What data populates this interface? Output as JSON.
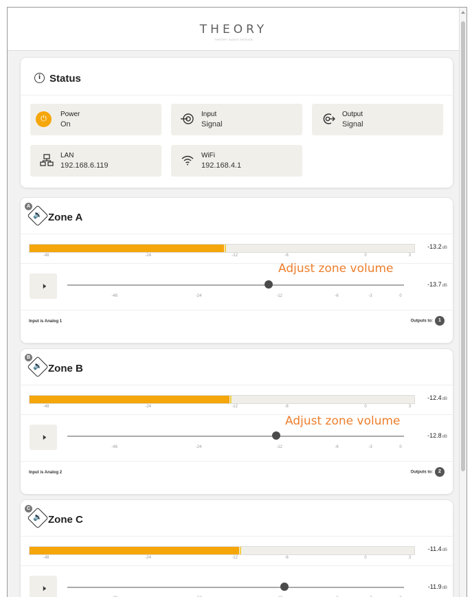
{
  "app": {
    "logo_text": "THEORY",
    "logo_tagline": "THEORY AUDIO DESIGN"
  },
  "status": {
    "title": "Status",
    "info_icon": "i",
    "tiles": [
      {
        "label": "Power",
        "value": "On",
        "icon": "power-icon"
      },
      {
        "label": "Input",
        "value": "Signal",
        "icon": "input-signal-icon"
      },
      {
        "label": "Output",
        "value": "Signal",
        "icon": "output-signal-icon"
      },
      {
        "label": "LAN",
        "value": "192.168.6.119",
        "icon": "lan-icon"
      },
      {
        "label": "WiFi",
        "value": "192.168.4.1",
        "icon": "wifi-icon"
      }
    ]
  },
  "zones": [
    {
      "badge": "A",
      "title": "Zone A",
      "meter_fraction": 0.505,
      "meter_db": "-13.2",
      "slider_fraction": 0.597,
      "slider_db": "-13.7",
      "input_text": "Input is Analog 1",
      "outputs_label": "Outputs to:",
      "outputs_badge": "1",
      "annotation": "Adjust zone volume"
    },
    {
      "badge": "B",
      "title": "Zone B",
      "meter_fraction": 0.52,
      "meter_db": "-12.4",
      "slider_fraction": 0.62,
      "slider_db": "-12.8",
      "input_text": "Input is Analog 2",
      "outputs_label": "Outputs to:",
      "outputs_badge": "2",
      "annotation": "Adjust zone volume"
    },
    {
      "badge": "C",
      "title": "Zone C",
      "meter_fraction": 0.545,
      "meter_db": "-11.4",
      "slider_fraction": 0.645,
      "slider_db": "-11.9"
    }
  ],
  "units": {
    "db": "dB"
  },
  "meter_ticks": [
    "-48",
    "-24",
    "-12",
    "-6",
    "0",
    "3"
  ],
  "slider_ticks": [
    "-48",
    "-24",
    "-12",
    "-6",
    "-3",
    "0"
  ],
  "colors": {
    "accent": "#f5a60a",
    "annotation": "#ee7e2c"
  }
}
